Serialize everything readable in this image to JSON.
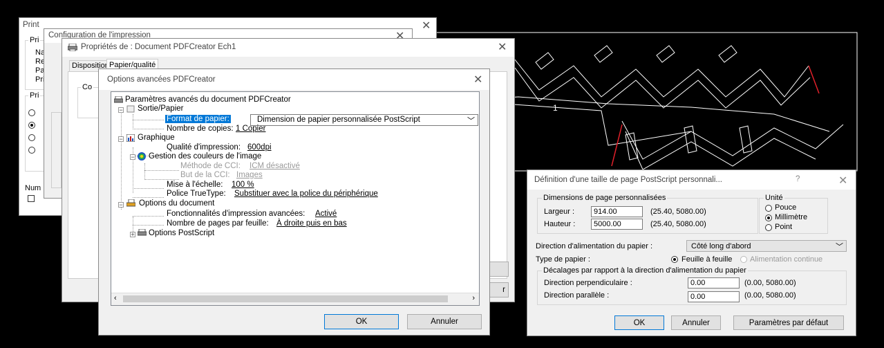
{
  "print_dialog": {
    "title": "Print",
    "printer_group": "Pri",
    "rows": [
      "Na",
      "Re",
      "Pa",
      "Pri"
    ],
    "range_group": "Pri",
    "num_label": "Num"
  },
  "config_dialog": {
    "title": "Configuration de l'impression"
  },
  "props_dialog": {
    "title": "Propriétés de : Document PDFCreator Ech1",
    "tabs": [
      "Disposition",
      "Papier/qualité"
    ],
    "group_label": "Co",
    "right_button": "r"
  },
  "advanced_dialog": {
    "title": "Options avancées PDFCreator",
    "tree": {
      "root": "Paramètres avancés du document PDFCreator",
      "sortie": "Sortie/Papier",
      "format_label": "Format de papier:",
      "format_value": "Dimension de papier personnalisée PostScript",
      "copies_label": "Nombre de copies:",
      "copies_value": "1 Copier",
      "graphique": "Graphique",
      "quality_label": "Qualité d'impression:",
      "quality_value": "600dpi",
      "color_mgmt": "Gestion des couleurs de l'image",
      "icm_method_label": "Méthode de CCI:",
      "icm_method_value": "ICM désactivé",
      "icm_goal_label": "But de la CCI:",
      "icm_goal_value": "Images",
      "scale_label": "Mise à l'échelle:",
      "scale_value": "100 %",
      "truetype_label": "Police TrueType:",
      "truetype_value": "Substituer avec la police du périphérique",
      "doc_options": "Options du document",
      "adv_features_label": "Fonctionnalités d'impression avancées:",
      "adv_features_value": "Activé",
      "pages_per_sheet_label": "Nombre de pages par feuille:",
      "pages_per_sheet_value": "À droite puis en bas",
      "ps_options": "Options PostScript"
    },
    "ok": "OK",
    "cancel": "Annuler"
  },
  "custom_page_dialog": {
    "title": "Définition d'une taille de page PostScript personnali...",
    "help": "?",
    "dims_group": "Dimensions de page personnalisées",
    "width_label": "Largeur :",
    "width_value": "914.00",
    "width_range": "(25.40, 5080.00)",
    "height_label": "Hauteur :",
    "height_value": "5000.00",
    "height_range": "(25.40, 5080.00)",
    "unit_group": "Unité",
    "units": [
      "Pouce",
      "Millimètre",
      "Point"
    ],
    "selected_unit": "Millimètre",
    "feed_label": "Direction d'alimentation du papier :",
    "feed_value": "Côté long d'abord",
    "paper_type_label": "Type de papier :",
    "paper_type_sheet": "Feuille à feuille",
    "paper_type_continuous": "Alimentation continue",
    "offset_group": "Décalages par rapport à la direction d'alimentation du papier",
    "perp_label": "Direction perpendiculaire :",
    "perp_value": "0.00",
    "perp_range": "(0.00, 5080.00)",
    "parallel_label": "Direction parallèle :",
    "parallel_value": "0.00",
    "parallel_range": "(0.00, 5080.00)",
    "ok": "OK",
    "cancel": "Annuler",
    "defaults": "Paramètres par défaut"
  },
  "cad_background": {
    "label": "1",
    "line_color": "#ffffff",
    "accent_color": "#e0202a"
  }
}
